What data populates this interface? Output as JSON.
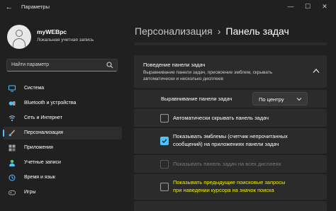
{
  "window": {
    "title": "Параметры",
    "back_glyph": "←",
    "min_glyph": "—",
    "max_glyph": "☐",
    "close_glyph": "✕"
  },
  "user": {
    "name": "myWEBpc",
    "account_type": "Локальная учетная запись"
  },
  "search": {
    "placeholder": "Найти параметр"
  },
  "sidebar": {
    "items": [
      {
        "label": "Система",
        "icon": "system-icon",
        "color": "#4cc2ff",
        "active": false
      },
      {
        "label": "Bluetooth и устройства",
        "icon": "bluetooth-icon",
        "color": "#4cc2ff",
        "active": false
      },
      {
        "label": "Сеть и Интернет",
        "icon": "network-icon",
        "color": "#9fd8ff",
        "active": false
      },
      {
        "label": "Персонализация",
        "icon": "brush-icon",
        "color": "#f4a261",
        "active": true
      },
      {
        "label": "Приложения",
        "icon": "apps-icon",
        "color": "#a0a0a0",
        "active": false
      },
      {
        "label": "Учетные записи",
        "icon": "accounts-icon",
        "color": "#5ec46b",
        "active": false
      },
      {
        "label": "Время и язык",
        "icon": "time-language-icon",
        "color": "#4cc2ff",
        "active": false
      },
      {
        "label": "Игры",
        "icon": "games-icon",
        "color": "#a0a0a0",
        "active": false
      }
    ]
  },
  "breadcrumb": {
    "parent": "Персонализация",
    "separator": "›",
    "current": "Панель задач"
  },
  "section": {
    "title": "Поведение панели задач",
    "description": "Выравнивание панели задач, присвоение эмблем, скрывать автоматически и несколько дисплеев"
  },
  "alignment": {
    "label": "Выравнивание панели задач",
    "value": "По центру"
  },
  "options": [
    {
      "lines": [
        "Автоматически скрывать панель задач"
      ],
      "checked": false,
      "disabled": false,
      "highlight": false
    },
    {
      "lines": [
        "Показывать эмблемы (счетчик непрочитанных",
        "сообщений) на приложениях панели задач"
      ],
      "checked": true,
      "disabled": false,
      "highlight": false
    },
    {
      "lines": [
        "Показывать панель задач на всех дисплеях"
      ],
      "checked": false,
      "disabled": true,
      "highlight": false
    },
    {
      "lines": [
        "Показывать предыдущие поисковые запросы",
        "при наведении курсора на значок поиска"
      ],
      "checked": false,
      "disabled": false,
      "highlight": true
    }
  ],
  "colors": {
    "accent": "#4cc2ff",
    "highlight_text": "#f2f200",
    "background": "#202020",
    "card": "#2b2b2b"
  }
}
